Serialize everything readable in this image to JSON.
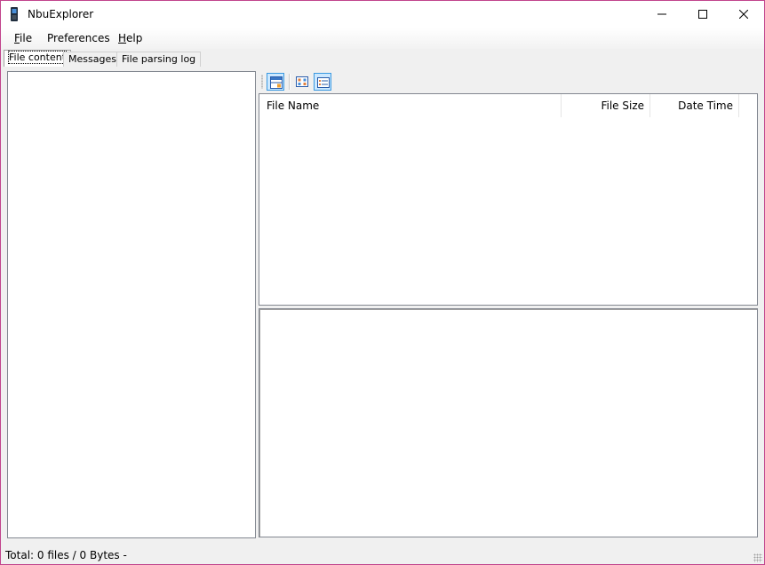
{
  "window": {
    "title": "NbuExplorer",
    "controls": {
      "minimize": "minimize-icon",
      "maximize": "maximize-icon",
      "close": "close-icon"
    }
  },
  "menu": {
    "file": {
      "accel": "F",
      "rest": "ile"
    },
    "preferences": {
      "accel": "",
      "rest": "Preferences"
    },
    "help": {
      "accel": "H",
      "rest": "elp"
    }
  },
  "tabs": [
    {
      "label": "File content",
      "active": true
    },
    {
      "label": "Messages",
      "active": false
    },
    {
      "label": "File parsing log",
      "active": false
    }
  ],
  "toolbar": {
    "buttons": [
      {
        "icon": "view-preview-icon",
        "checked": true
      },
      {
        "icon": "large-icons-view-icon",
        "checked": false
      },
      {
        "icon": "details-view-icon",
        "checked": true
      }
    ]
  },
  "file_list": {
    "columns": [
      "File Name",
      "File Size",
      "Date Time"
    ],
    "rows": []
  },
  "status": {
    "text": "Total: 0 files / 0 Bytes  -"
  },
  "colors": {
    "window_border": "#c1448d",
    "checked_button": "#cce8ff",
    "checked_border": "#3b99e0"
  }
}
